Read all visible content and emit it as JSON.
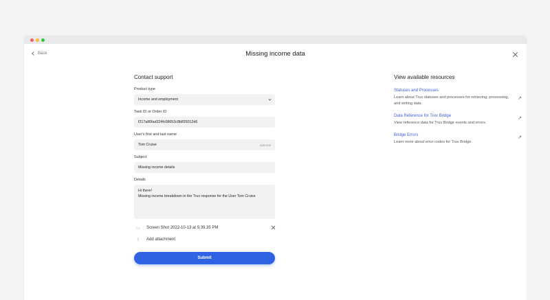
{
  "window": {
    "back_label": "Back",
    "title": "Missing income data"
  },
  "form": {
    "section_title": "Contact support",
    "product_type": {
      "label": "Product type",
      "value": "Income and employment"
    },
    "task_id": {
      "label": "Task ID or Order ID",
      "value": "f217a80fad324fc08653c8fdf35012d6"
    },
    "user_name": {
      "label": "User's first and last name",
      "value": "Tom Cruise",
      "hint": "optional"
    },
    "subject": {
      "label": "Subject",
      "value": "Missing income details"
    },
    "details": {
      "label": "Details",
      "line1": "Hi there!",
      "line2": "Missing income breakdown  in the Truv response for the User Tom Cruise"
    },
    "attachment_name": "Screen Shot 2022-10-13 at 9.39.35 PM",
    "add_attachment_label": "Add attachment",
    "submit_label": "Submit"
  },
  "resources": {
    "title": "View available resources",
    "items": [
      {
        "link": "Statuses and Processes",
        "desc": "Learn about Truv statuses and processes for retrieving, processing, and writing data."
      },
      {
        "link": "Data Reference for Truv Bridge",
        "desc": "View reference data for Truv Bridge events and errors."
      },
      {
        "link": "Bridge Errors",
        "desc": "Learn more about error codes for Truv Bridge."
      }
    ]
  }
}
